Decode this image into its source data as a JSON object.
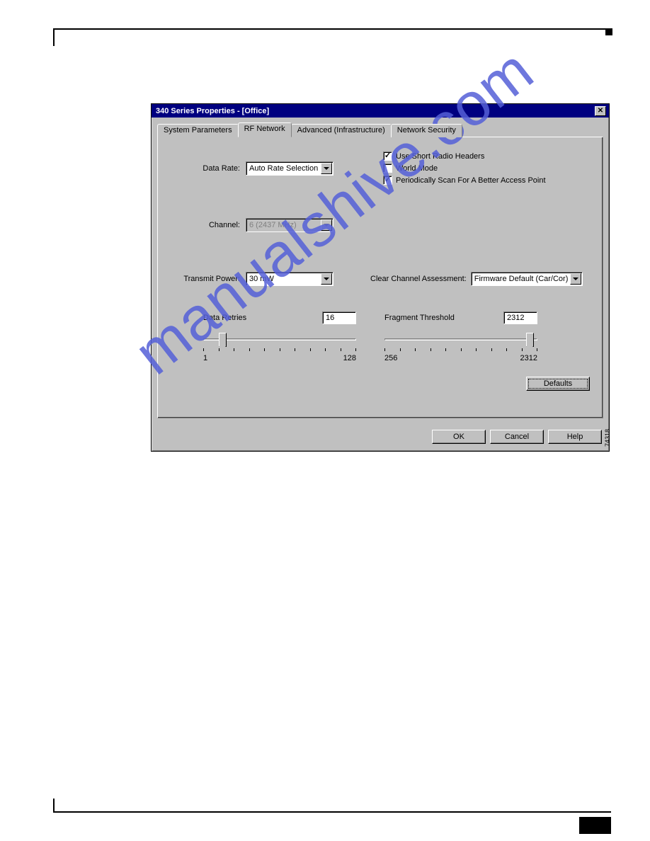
{
  "dialog": {
    "title": "340 Series Properties - [Office]",
    "tabs": [
      "System Parameters",
      "RF Network",
      "Advanced (Infrastructure)",
      "Network Security"
    ],
    "active_tab_index": 1,
    "labels": {
      "data_rate": "Data Rate:",
      "channel": "Channel:",
      "transmit_power": "Transmit Power:",
      "clear_channel": "Clear Channel Assessment:",
      "data_retries": "Data Retries",
      "fragment_threshold": "Fragment Threshold"
    },
    "fields": {
      "data_rate": "Auto Rate Selection",
      "channel": "6   (2437 MHz)",
      "transmit_power": "30 mW",
      "clear_channel": "Firmware Default (Car/Cor)",
      "data_retries": "16",
      "fragment_threshold": "2312"
    },
    "checkboxes": {
      "use_short_radio_headers": {
        "label": "Use Short Radio Headers",
        "checked": true
      },
      "world_mode": {
        "label": "World Mode",
        "checked": false
      },
      "periodically_scan": {
        "label": "Periodically Scan For A Better Access Point",
        "checked": true
      }
    },
    "sliders": {
      "data_retries": {
        "min": "1",
        "max": "128"
      },
      "fragment_threshold": {
        "min": "256",
        "max": "2312"
      }
    },
    "buttons": {
      "defaults": "Defaults",
      "ok": "OK",
      "cancel": "Cancel",
      "help": "Help"
    },
    "side_number": "74318"
  },
  "watermark": "manualshive.com"
}
